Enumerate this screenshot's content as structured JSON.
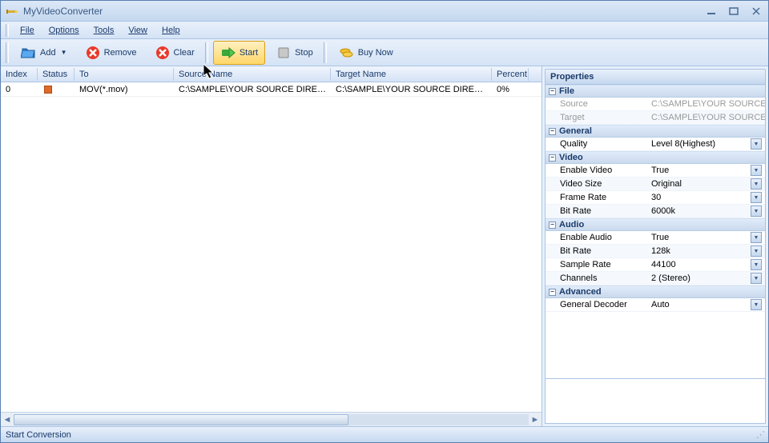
{
  "window": {
    "title": "MyVideoConverter"
  },
  "menu": {
    "file": "File",
    "options": "Options",
    "tools": "Tools",
    "view": "View",
    "help": "Help"
  },
  "toolbar": {
    "add": "Add",
    "remove": "Remove",
    "clear": "Clear",
    "start": "Start",
    "stop": "Stop",
    "buy": "Buy Now"
  },
  "grid": {
    "headers": {
      "index": "Index",
      "status": "Status",
      "to": "To",
      "source": "Source Name",
      "target": "Target Name",
      "percent": "Percent"
    },
    "rows": [
      {
        "index": "0",
        "to": "MOV(*.mov)",
        "source": "C:\\SAMPLE\\YOUR SOURCE DIRECTOR...",
        "target": "C:\\SAMPLE\\YOUR SOURCE DIRECTOR...",
        "percent": "0%"
      }
    ]
  },
  "properties": {
    "title": "Properties",
    "sections": {
      "file": {
        "label": "File",
        "source_label": "Source",
        "source_value": "C:\\SAMPLE\\YOUR SOURCE",
        "target_label": "Target",
        "target_value": "C:\\SAMPLE\\YOUR SOURCE"
      },
      "general": {
        "label": "General",
        "quality_label": "Quality",
        "quality_value": "Level 8(Highest)"
      },
      "video": {
        "label": "Video",
        "enable_label": "Enable Video",
        "enable_value": "True",
        "size_label": "Video Size",
        "size_value": "Original",
        "fps_label": "Frame Rate",
        "fps_value": "30",
        "bitrate_label": "Bit Rate",
        "bitrate_value": "6000k"
      },
      "audio": {
        "label": "Audio",
        "enable_label": "Enable Audio",
        "enable_value": "True",
        "bitrate_label": "Bit Rate",
        "bitrate_value": "128k",
        "sample_label": "Sample Rate",
        "sample_value": "44100",
        "channels_label": "Channels",
        "channels_value": "2 (Stereo)"
      },
      "advanced": {
        "label": "Advanced",
        "decoder_label": "General Decoder",
        "decoder_value": "Auto"
      }
    }
  },
  "statusbar": {
    "text": "Start Conversion"
  }
}
